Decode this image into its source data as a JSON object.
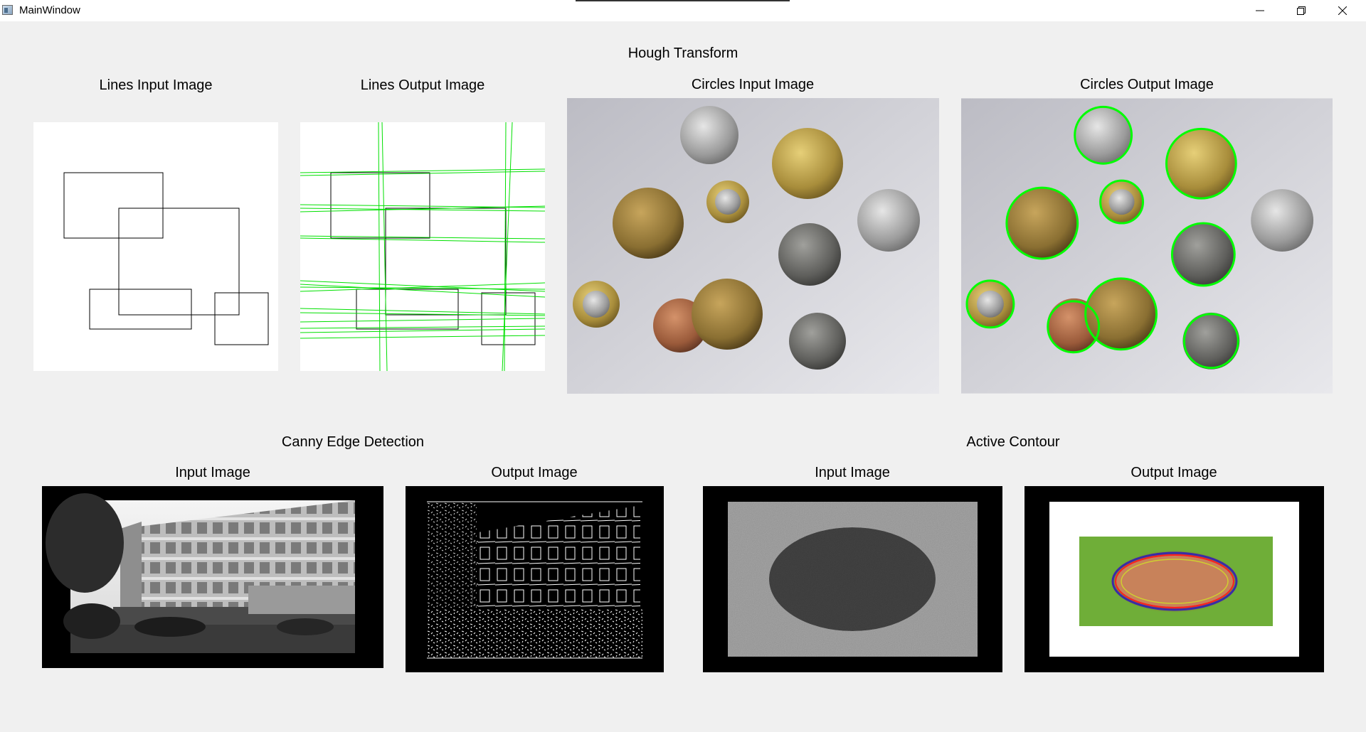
{
  "window": {
    "title": "MainWindow",
    "minimize_icon": "minimize-icon",
    "maximize_icon": "restore-icon",
    "close_icon": "close-icon"
  },
  "hough": {
    "section_title": "Hough Transform",
    "lines_input_label": "Lines Input Image",
    "lines_output_label": "Lines Output Image",
    "circles_input_label": "Circles Input Image",
    "circles_output_label": "Circles Output Image"
  },
  "canny": {
    "section_title": "Canny Edge Detection",
    "input_label": "Input Image",
    "output_label": "Output Image"
  },
  "active_contour": {
    "section_title": "Active Contour",
    "input_label": "Input Image",
    "output_label": "Output Image"
  },
  "colors": {
    "background": "#f0f0f0",
    "detected_line": "#00e000",
    "detected_circle": "#00ff00"
  }
}
